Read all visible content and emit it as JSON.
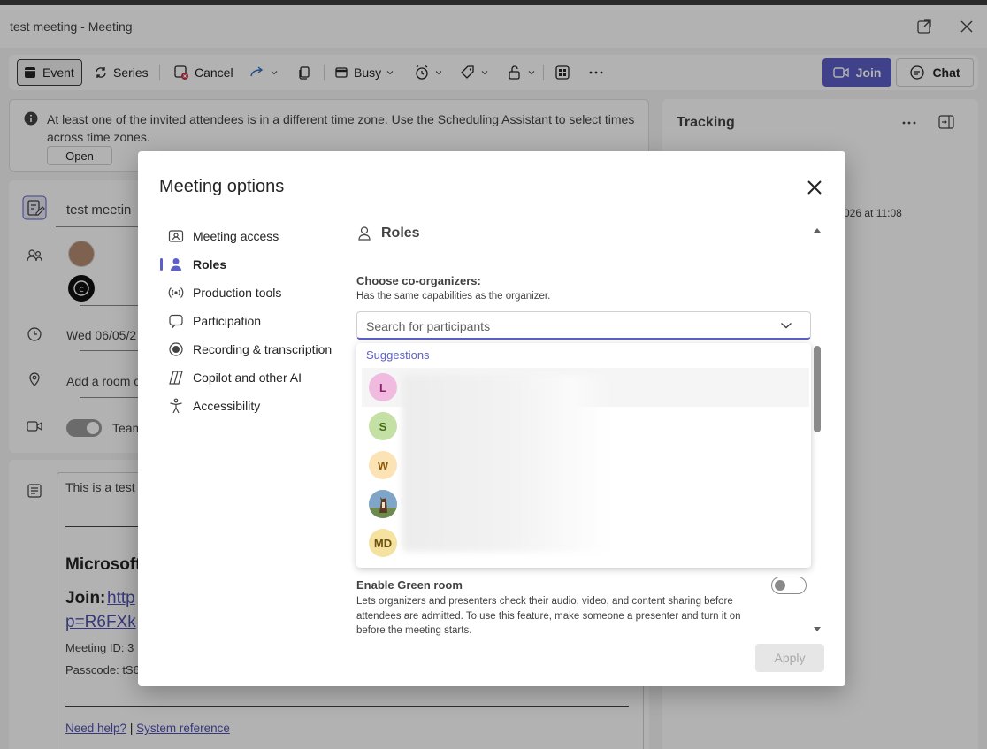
{
  "window": {
    "title": "test meeting - Meeting",
    "popout_icon": "popout-icon",
    "close_icon": "close-icon"
  },
  "toolbar": {
    "event_label": "Event",
    "series_label": "Series",
    "cancel_label": "Cancel",
    "busy_label": "Busy",
    "join_label": "Join",
    "chat_label": "Chat"
  },
  "banner": {
    "message": "At least one of the invited attendees is in a different time zone. Use the Scheduling Assistant to select times across time zones.",
    "open_label": "Open"
  },
  "form": {
    "title_value": "test meetin",
    "date_value": "Wed 06/05/2",
    "location_placeholder": "Add a room o",
    "teams_label": "Team"
  },
  "body": {
    "line1": "This is a test",
    "heading": "Microsoft",
    "join_label": "Join:",
    "join_link": "http",
    "link2": "p=R6FXk",
    "meeting_id": "Meeting ID: 3",
    "passcode": "Passcode: tS6",
    "need_help": "Need help?",
    "separator": " | ",
    "system_reference": "System reference"
  },
  "tracking": {
    "title": "Tracking",
    "timestamp": "026 at 11:08"
  },
  "dialog": {
    "title": "Meeting options",
    "nav": [
      {
        "label": "Meeting access",
        "icon": "id-card-icon"
      },
      {
        "label": "Roles",
        "icon": "person-icon"
      },
      {
        "label": "Production tools",
        "icon": "broadcast-icon"
      },
      {
        "label": "Participation",
        "icon": "chat-bubble-icon"
      },
      {
        "label": "Recording & transcription",
        "icon": "record-icon"
      },
      {
        "label": "Copilot and other AI",
        "icon": "copilot-icon"
      },
      {
        "label": "Accessibility",
        "icon": "accessibility-icon"
      }
    ],
    "active_nav": "Roles",
    "section_title": "Roles",
    "co_organizers": {
      "label": "Choose co-organizers:",
      "description": "Has the same capabilities as the organizer.",
      "search_placeholder": "Search for participants"
    },
    "suggestions": {
      "header": "Suggestions",
      "items": [
        {
          "initials": "L",
          "color": "#f1bbe0",
          "text_color": "#8a1f6a"
        },
        {
          "initials": "S",
          "color": "#c5e0a5",
          "text_color": "#3f6a16"
        },
        {
          "initials": "W",
          "color": "#fce3b6",
          "text_color": "#8a5a0a"
        },
        {
          "initials": "",
          "color": "#7fa6c9",
          "text_color": "#ffffff"
        },
        {
          "initials": "MD",
          "color": "#f5e1a0",
          "text_color": "#6b5210"
        }
      ]
    },
    "green_room": {
      "title": "Enable Green room",
      "description": "Lets organizers and presenters check their audio, video, and content sharing before attendees are admitted. To use this feature, make someone a presenter and turn it on before the meeting starts.",
      "enabled": false
    },
    "apply_label": "Apply"
  }
}
